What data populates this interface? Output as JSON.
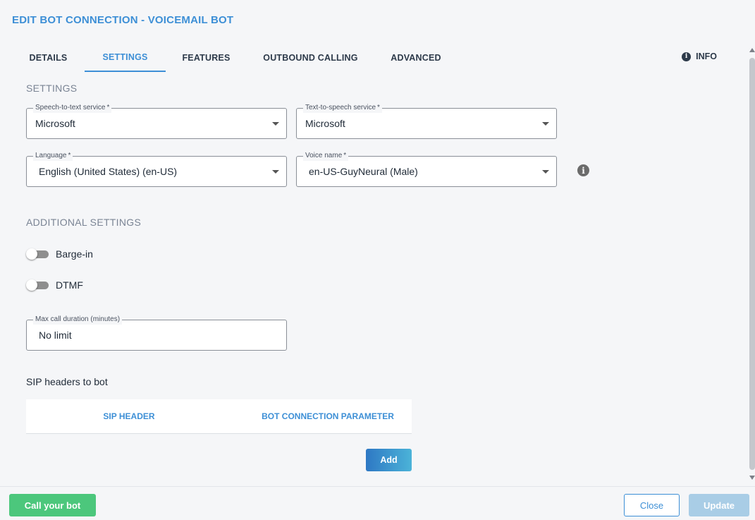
{
  "title": "EDIT BOT CONNECTION - VOICEMAIL BOT",
  "tabs": [
    "DETAILS",
    "SETTINGS",
    "FEATURES",
    "OUTBOUND CALLING",
    "ADVANCED"
  ],
  "active_tab": "SETTINGS",
  "info_label": "INFO",
  "settings": {
    "section_title": "SETTINGS",
    "stt": {
      "label": "Speech-to-text service",
      "required": "*",
      "value": "Microsoft"
    },
    "tts": {
      "label": "Text-to-speech service",
      "required": "*",
      "value": "Microsoft"
    },
    "language": {
      "label": "Language",
      "required": "*",
      "value": "English (United States) (en-US)"
    },
    "voice": {
      "label": "Voice name",
      "required": "*",
      "value": "en-US-GuyNeural (Male)"
    }
  },
  "additional": {
    "section_title": "ADDITIONAL SETTINGS",
    "barge_in": {
      "label": "Barge-in",
      "enabled": false
    },
    "dtmf": {
      "label": "DTMF",
      "enabled": false
    },
    "max_duration": {
      "label": "Max call duration (minutes)",
      "value": "No limit"
    }
  },
  "sip": {
    "title": "SIP headers to bot",
    "columns": [
      "SIP HEADER",
      "BOT CONNECTION PARAMETER"
    ],
    "add_label": "Add"
  },
  "footer": {
    "call_label": "Call your bot",
    "close_label": "Close",
    "update_label": "Update"
  },
  "icons": {
    "info": "info-icon",
    "help": "help-icon",
    "dropdown": "chevron-down-icon"
  },
  "colors": {
    "accent": "#3d8fd6",
    "call_button": "#4cc77c",
    "update_disabled": "#a9cde6"
  }
}
